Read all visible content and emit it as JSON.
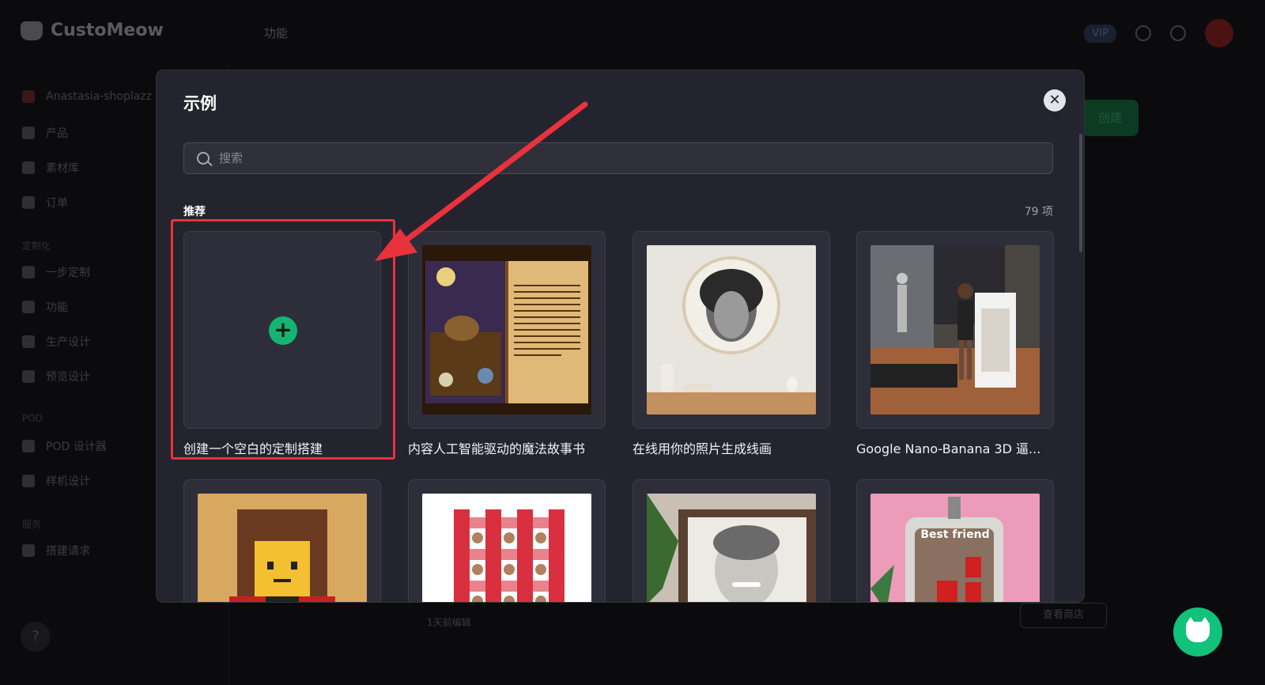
{
  "app": {
    "brand": "CustoMeow",
    "top_nav": "功能",
    "vip_label": "VIP",
    "background_create_label": "创建",
    "background_shop_label": "查看商店",
    "background_row_time": "1天前编辑"
  },
  "sidebar": {
    "store": "Anastasia-shoplazz",
    "items": [
      {
        "label": "产品",
        "icon": "tag-icon"
      },
      {
        "label": "素材库",
        "icon": "library-icon"
      },
      {
        "label": "订单",
        "icon": "document-icon"
      }
    ],
    "section_custom": "定制化",
    "custom_items": [
      {
        "label": "一步定制",
        "icon": "wand-icon"
      },
      {
        "label": "功能",
        "icon": "puzzle-icon"
      },
      {
        "label": "生产设计",
        "icon": "palette-icon"
      },
      {
        "label": "预览设计",
        "icon": "preview-icon"
      }
    ],
    "section_pod": "POD",
    "pod_items": [
      {
        "label": "POD 设计器",
        "icon": "pod-icon"
      },
      {
        "label": "样机设计",
        "icon": "shirt-icon"
      }
    ],
    "section_service": "服务",
    "service_items": [
      {
        "label": "搭建请求",
        "icon": "request-icon"
      }
    ],
    "help": "?"
  },
  "modal": {
    "title": "示例",
    "close_icon": "close-icon",
    "search_placeholder": "搜索",
    "section_label": "推荐",
    "count_label": "79 项",
    "cards": [
      {
        "title": "创建一个空白的定制搭建",
        "thumb": "blank",
        "plus": "+"
      },
      {
        "title": "内容人工智能驱动的魔法故事书",
        "thumb": "storybook"
      },
      {
        "title": "在线用你的照片生成线画",
        "thumb": "string-art"
      },
      {
        "title": "Google Nano-Banana 3D 逼...",
        "thumb": "figurine"
      },
      {
        "title": "",
        "thumb": "brick-portrait"
      },
      {
        "title": "",
        "thumb": "face-blanket"
      },
      {
        "title": "",
        "thumb": "pencil-portrait"
      },
      {
        "title": "",
        "thumb": "best-friend-tag",
        "thumb_text": "Best friend"
      }
    ]
  },
  "colors": {
    "modal_bg": "#24242e",
    "accent_green": "#13b571",
    "annotation_red": "#e8323c"
  }
}
